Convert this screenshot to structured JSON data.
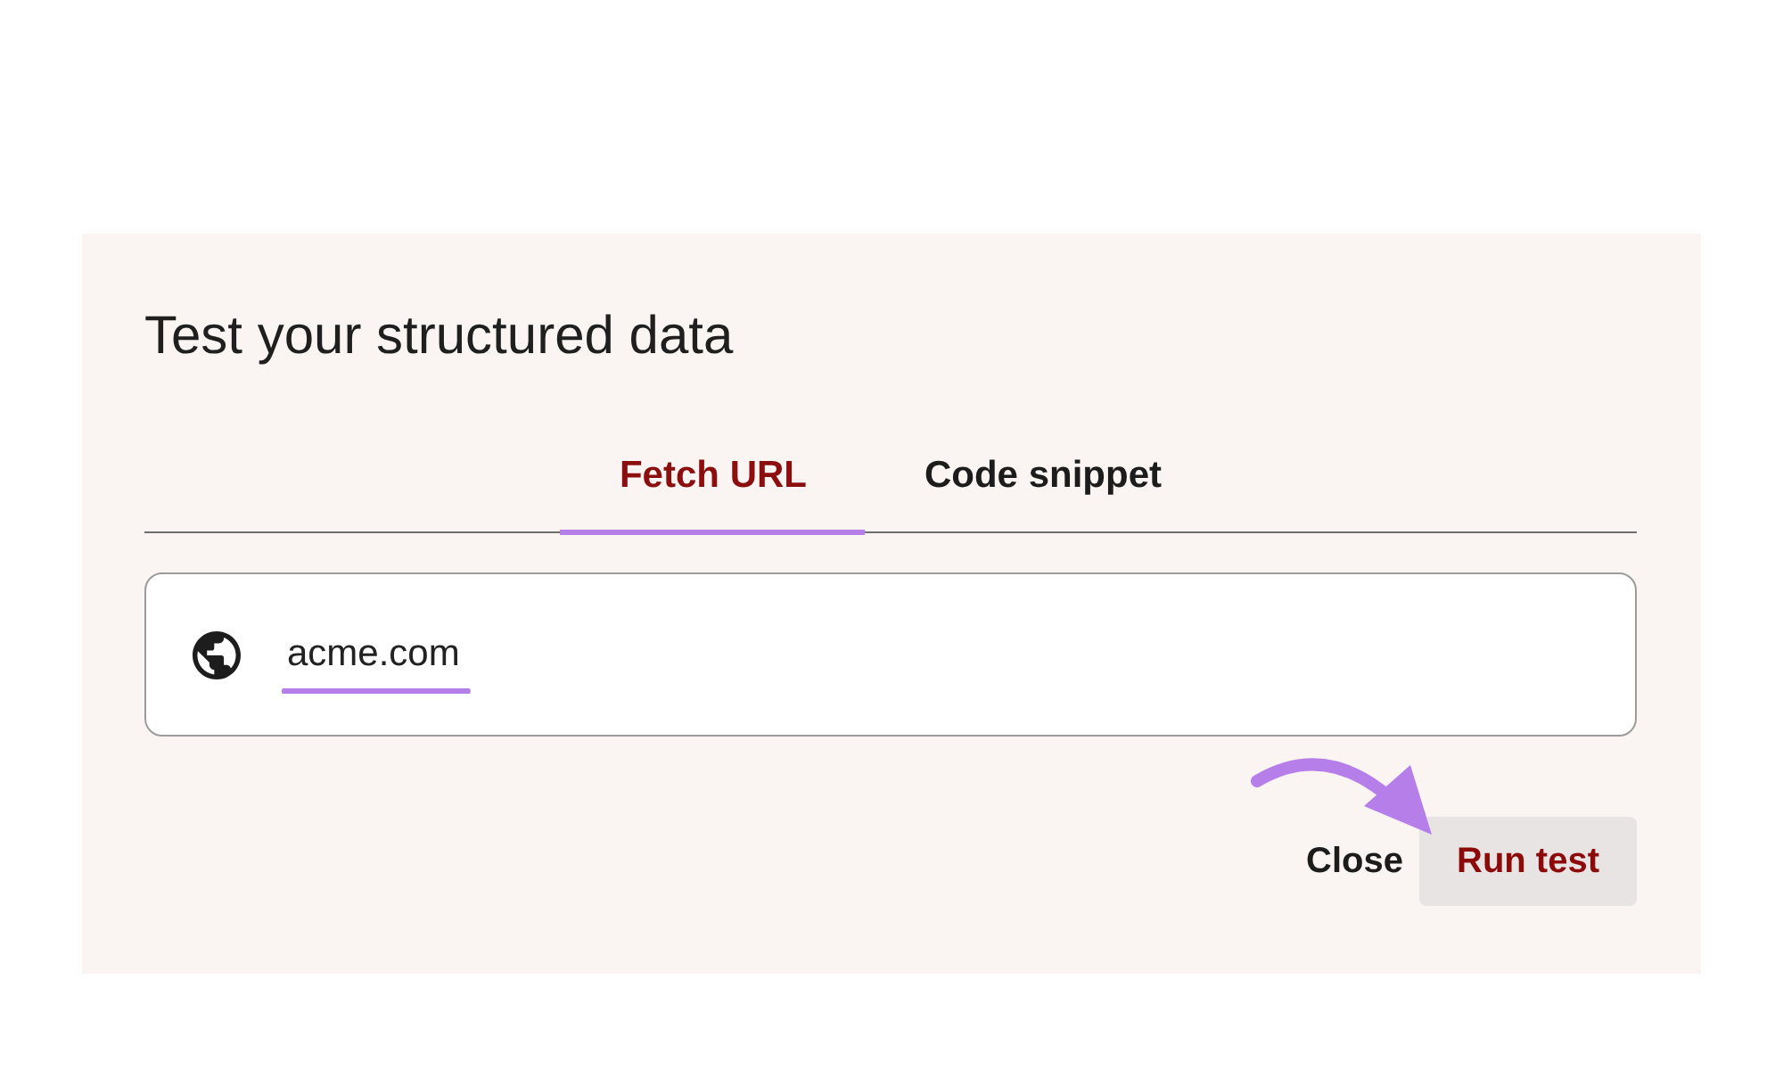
{
  "dialog": {
    "title": "Test your structured data",
    "tabs": [
      {
        "label": "Fetch URL",
        "selected": true
      },
      {
        "label": "Code snippet",
        "selected": false
      }
    ],
    "url_field": {
      "value": "acme.com"
    },
    "close_button": {
      "label": "Close"
    },
    "run_button": {
      "label": "Run test"
    }
  }
}
